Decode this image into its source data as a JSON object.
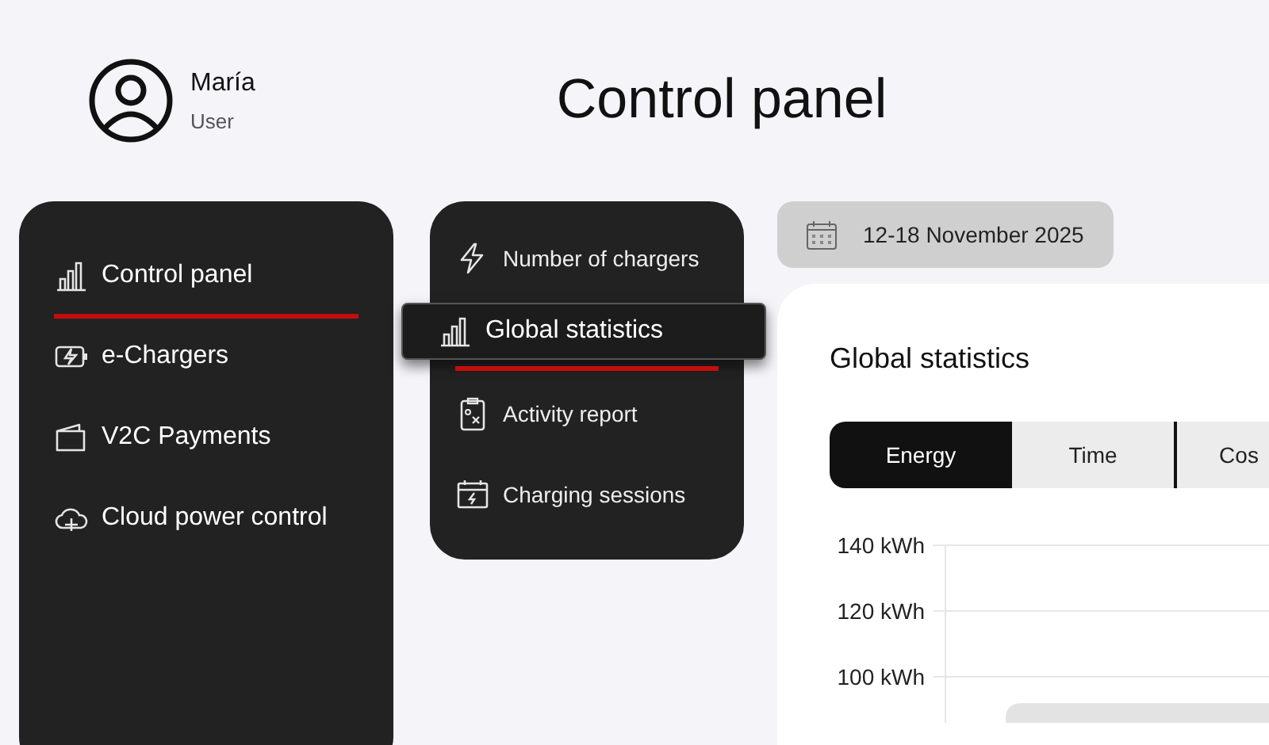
{
  "user": {
    "name": "María",
    "role": "User"
  },
  "page_title": "Control panel",
  "sidebar": {
    "items": [
      {
        "label": "Control panel",
        "selected": true
      },
      {
        "label": "e-Chargers",
        "selected": false
      },
      {
        "label": "V2C Payments",
        "selected": false
      },
      {
        "label": "Cloud power control",
        "selected": false
      }
    ]
  },
  "submenu": {
    "items": [
      {
        "label": "Number of chargers",
        "selected": false
      },
      {
        "label": "Global statistics",
        "selected": true
      },
      {
        "label": "Activity report",
        "selected": false
      },
      {
        "label": "Charging sessions",
        "selected": false
      }
    ]
  },
  "date_range": "12-18 November 2025",
  "card": {
    "title": "Global statistics",
    "tabs": [
      {
        "label": "Energy",
        "selected": true
      },
      {
        "label": "Time",
        "selected": false
      },
      {
        "label": "Cos",
        "selected": false
      }
    ],
    "chart_data": {
      "type": "bar",
      "ylim": [
        86,
        140
      ],
      "yticks": [
        {
          "value": 100,
          "label": "100 kWh"
        },
        {
          "value": 120,
          "label": "120 kWh"
        },
        {
          "value": 140,
          "label": "140 kWh"
        }
      ],
      "values": [
        92
      ]
    }
  }
}
